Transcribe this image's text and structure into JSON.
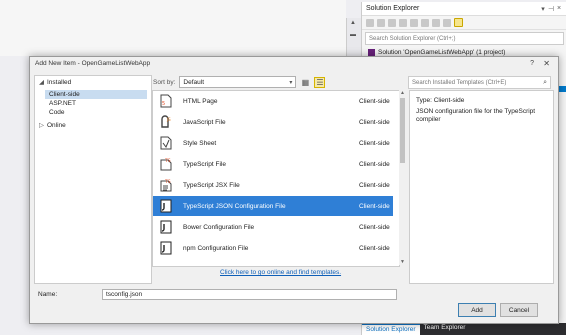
{
  "ide": {
    "solution_explorer": {
      "title": "Solution Explorer",
      "search_placeholder": "Search Solution Explorer (Ctrl+;)",
      "solution_item": "Solution 'OpenGameListWebApp' (1 project)",
      "tabs": [
        "Solution Explorer",
        "Team Explorer"
      ]
    }
  },
  "dialog": {
    "title": "Add New Item - OpenGameListWebApp",
    "help_label": "?",
    "close_label": "✕",
    "nav": {
      "installed_label": "Installed",
      "items": [
        "Client-side",
        "ASP.NET",
        "Code"
      ],
      "online_label": "Online"
    },
    "sort_label": "Sort by:",
    "sort_value": "Default",
    "search_placeholder": "Search Installed Templates (Ctrl+E)",
    "templates": [
      {
        "name": "HTML Page",
        "category": "Client-side",
        "icon": "html-file-icon"
      },
      {
        "name": "JavaScript File",
        "category": "Client-side",
        "icon": "js-file-icon"
      },
      {
        "name": "Style Sheet",
        "category": "Client-side",
        "icon": "css-file-icon"
      },
      {
        "name": "TypeScript File",
        "category": "Client-side",
        "icon": "ts-file-icon"
      },
      {
        "name": "TypeScript JSX File",
        "category": "Client-side",
        "icon": "tsx-file-icon"
      },
      {
        "name": "TypeScript JSON Configuration File",
        "category": "Client-side",
        "icon": "json-config-icon",
        "selected": true
      },
      {
        "name": "Bower Configuration File",
        "category": "Client-side",
        "icon": "json-config-icon"
      },
      {
        "name": "npm Configuration File",
        "category": "Client-side",
        "icon": "json-config-icon"
      }
    ],
    "online_link": "Click here to go online and find templates.",
    "details": {
      "type_label": "Type: Client-side",
      "description": "JSON configuration file for the TypeScript compiler"
    },
    "name_label": "Name:",
    "name_value": "tsconfig.json",
    "add_label": "Add",
    "cancel_label": "Cancel"
  }
}
